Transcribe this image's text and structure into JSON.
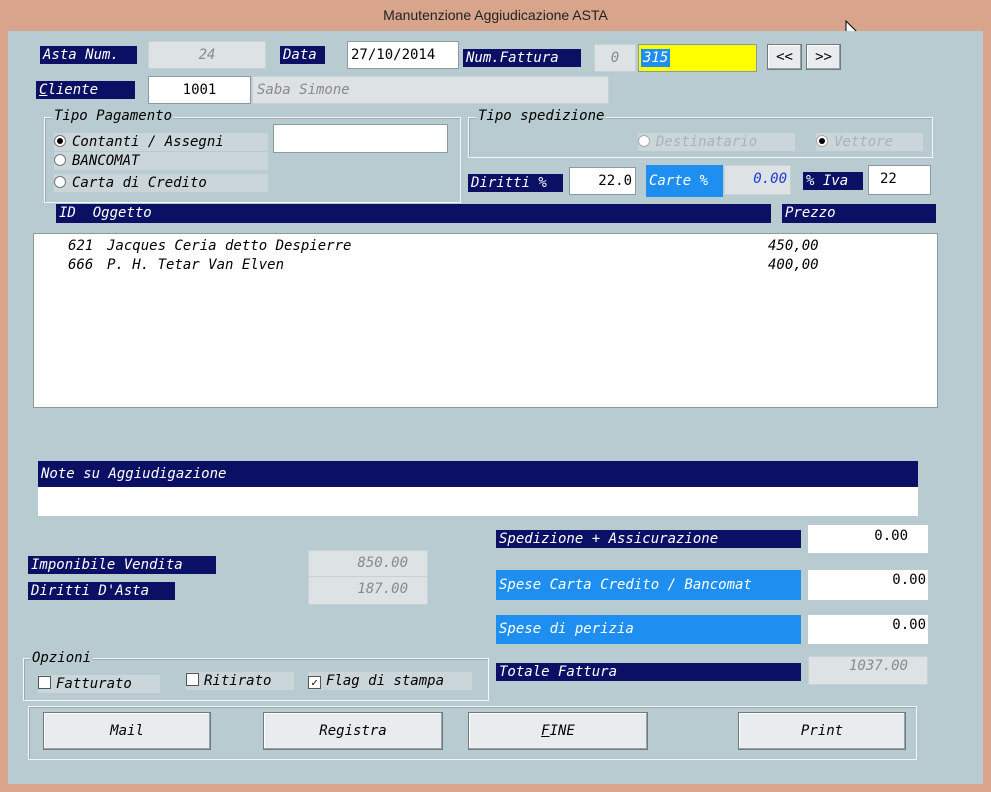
{
  "window": {
    "title": "Manutenzione Aggiudicazione ASTA"
  },
  "header": {
    "asta_label": "Asta Num.",
    "asta_value": "24",
    "data_label": "Data",
    "data_value": "27/10/2014",
    "fattura_label": "Num.Fattura",
    "fattura_prefix": "0",
    "fattura_value": "315",
    "prev_label": "<<",
    "next_label": ">>",
    "cliente_label_pre": "C",
    "cliente_label_post": "liente",
    "cliente_code": "1001",
    "cliente_name": "Saba Simone"
  },
  "pagamento": {
    "title": "Tipo Pagamento",
    "options": [
      "Contanti / Assegni",
      "BANCOMAT",
      "Carta di Credito"
    ],
    "selected": 0,
    "extra_value": ""
  },
  "spedizione": {
    "title": "Tipo spedizione",
    "options": [
      "Destinatario",
      "Vettore"
    ],
    "selected": 1
  },
  "rates": {
    "diritti_label": "Diritti %",
    "diritti_value": "22.0",
    "carte_label": "Carte %",
    "carte_value": "0.00",
    "iva_label": "% Iva",
    "iva_value": "22"
  },
  "items": {
    "col_id_oggetto": "ID  Oggetto",
    "col_prezzo": "Prezzo",
    "rows": [
      {
        "id": "621",
        "oggetto": "Jacques Ceria detto Despierre",
        "prezzo": "450,00"
      },
      {
        "id": "666",
        "oggetto": "P. H. Tetar Van Elven",
        "prezzo": "400,00"
      }
    ]
  },
  "note": {
    "label": "Note su Aggiudigazione",
    "value": ""
  },
  "totals": {
    "imponibile_label": "Imponibile Vendita",
    "imponibile_value": "850.00",
    "diritti_asta_label": "Diritti D'Asta",
    "diritti_asta_value": "187.00",
    "spedizione_label": "Spedizione + Assicurazione",
    "spedizione_value": "0.00",
    "spese_carta_label": "Spese Carta Credito / Bancomat",
    "spese_carta_value": "0.00",
    "perizia_label": "Spese di perizia",
    "perizia_value": "0.00",
    "totale_label": "Totale Fattura",
    "totale_value": "1037.00"
  },
  "opzioni": {
    "title": "Opzioni",
    "fatturato_label": "Fatturato",
    "fatturato_checked": false,
    "ritirato_label": "Ritirato",
    "ritirato_checked": false,
    "flag_label": "Flag di stampa",
    "flag_checked": true
  },
  "buttons": {
    "mail": "Mail",
    "registra": "Registra",
    "fine_pre": "F",
    "fine_post": "INE",
    "print": "Print"
  },
  "colors": {
    "label_navy": "#0b1065",
    "label_blue": "#1e8ff0",
    "highlight_yellow": "#ffff00",
    "window_bg": "#b7cbd1",
    "frame": "#d8a58c"
  }
}
